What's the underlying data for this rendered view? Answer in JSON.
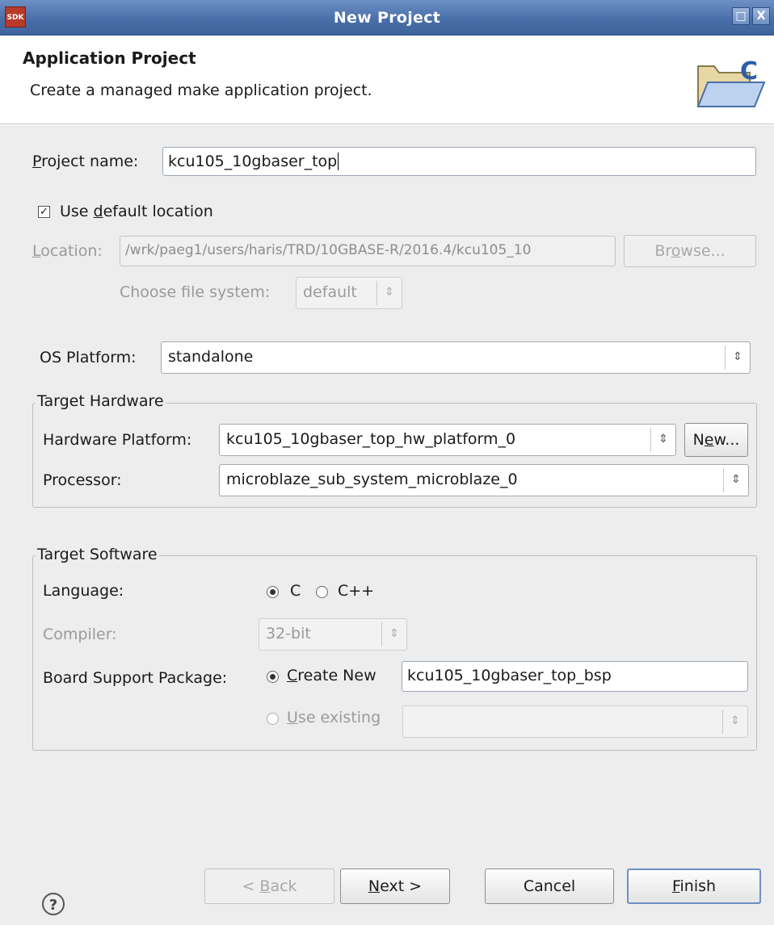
{
  "window": {
    "title": "New Project",
    "app_icon_text": "SDK",
    "maximize_glyph": "□",
    "close_glyph": "X"
  },
  "header": {
    "title": "Application Project",
    "description": "Create a managed make application project."
  },
  "project_name": {
    "label_mnemonic": "P",
    "label_rest": "roject name:",
    "value": "kcu105_10gbaser_top"
  },
  "use_default_location": {
    "checked": true,
    "label_pre": "Use ",
    "label_mnemonic": "d",
    "label_post": "efault location"
  },
  "location": {
    "label_mnemonic": "L",
    "label_rest": "ocation:",
    "value": "/wrk/paeg1/users/haris/TRD/10GBASE-R/2016.4/kcu105_10",
    "browse_pre": "Br",
    "browse_mnemonic": "o",
    "browse_post": "wse..."
  },
  "file_system": {
    "label": "Choose file system:",
    "value": "default"
  },
  "os_platform": {
    "label": "OS Platform:",
    "value": "standalone"
  },
  "target_hardware": {
    "legend": "Target Hardware",
    "hw_platform_label": "Hardware Platform:",
    "hw_platform_value": "kcu105_10gbaser_top_hw_platform_0",
    "new_pre": "N",
    "new_mnemonic": "e",
    "new_post": "w...",
    "processor_label": "Processor:",
    "processor_value": "microblaze_sub_system_microblaze_0"
  },
  "target_software": {
    "legend": "Target Software",
    "language_label": "Language:",
    "lang_c": "C",
    "lang_cpp": "C++",
    "selected_language": "C",
    "compiler_label": "Compiler:",
    "compiler_value": "32-bit",
    "bsp_label": "Board Support Package:",
    "create_new_mnemonic": "C",
    "create_new_rest": "reate New",
    "bsp_name": "kcu105_10gbaser_top_bsp",
    "use_existing_mnemonic": "U",
    "use_existing_rest": "se existing",
    "selected_bsp_option": "create_new"
  },
  "footer": {
    "help_glyph": "?",
    "back_pre": "< ",
    "back_mnemonic": "B",
    "back_post": "ack",
    "next_mnemonic": "N",
    "next_post": "ext >",
    "cancel": "Cancel",
    "finish_mnemonic": "F",
    "finish_post": "inish"
  },
  "icons": {
    "spinner": "⇕",
    "check": "✓"
  }
}
